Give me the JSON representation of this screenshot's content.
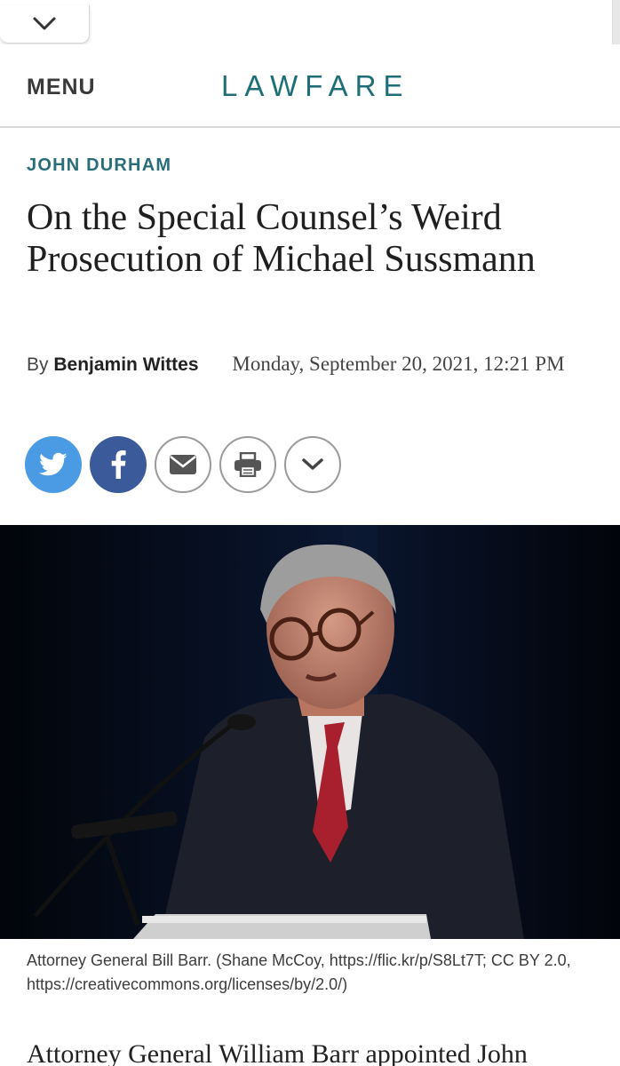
{
  "header": {
    "menu_label": "MENU",
    "logo_text": "LAWFARE"
  },
  "article": {
    "category": "JOHN DURHAM",
    "title": "On the Special Counsel’s Weird Prosecution of Michael Sussmann",
    "byline_prefix": "By",
    "author": "Benjamin Wittes",
    "date": "Monday, September 20, 2021, 12:21 PM",
    "photo_caption": "Attorney General Bill Barr. (Shane McCoy, https://flic.kr/p/S8Lt7T; CC BY 2.0, https://creativecommons.org/licenses/by/2.0/)",
    "body_first_line": "Attorney General William Barr appointed John"
  },
  "share_buttons": [
    {
      "icon": "twitter-icon",
      "color": "#4a9be3"
    },
    {
      "icon": "facebook-icon",
      "color": "#3b5a9a"
    },
    {
      "icon": "email-icon"
    },
    {
      "icon": "print-icon"
    },
    {
      "icon": "chevron-down-icon"
    }
  ],
  "colors": {
    "brand_teal": "#1e6e78",
    "category_teal": "#2a6d7a",
    "twitter_blue": "#4a9be3",
    "facebook_blue": "#3b5a9a"
  }
}
